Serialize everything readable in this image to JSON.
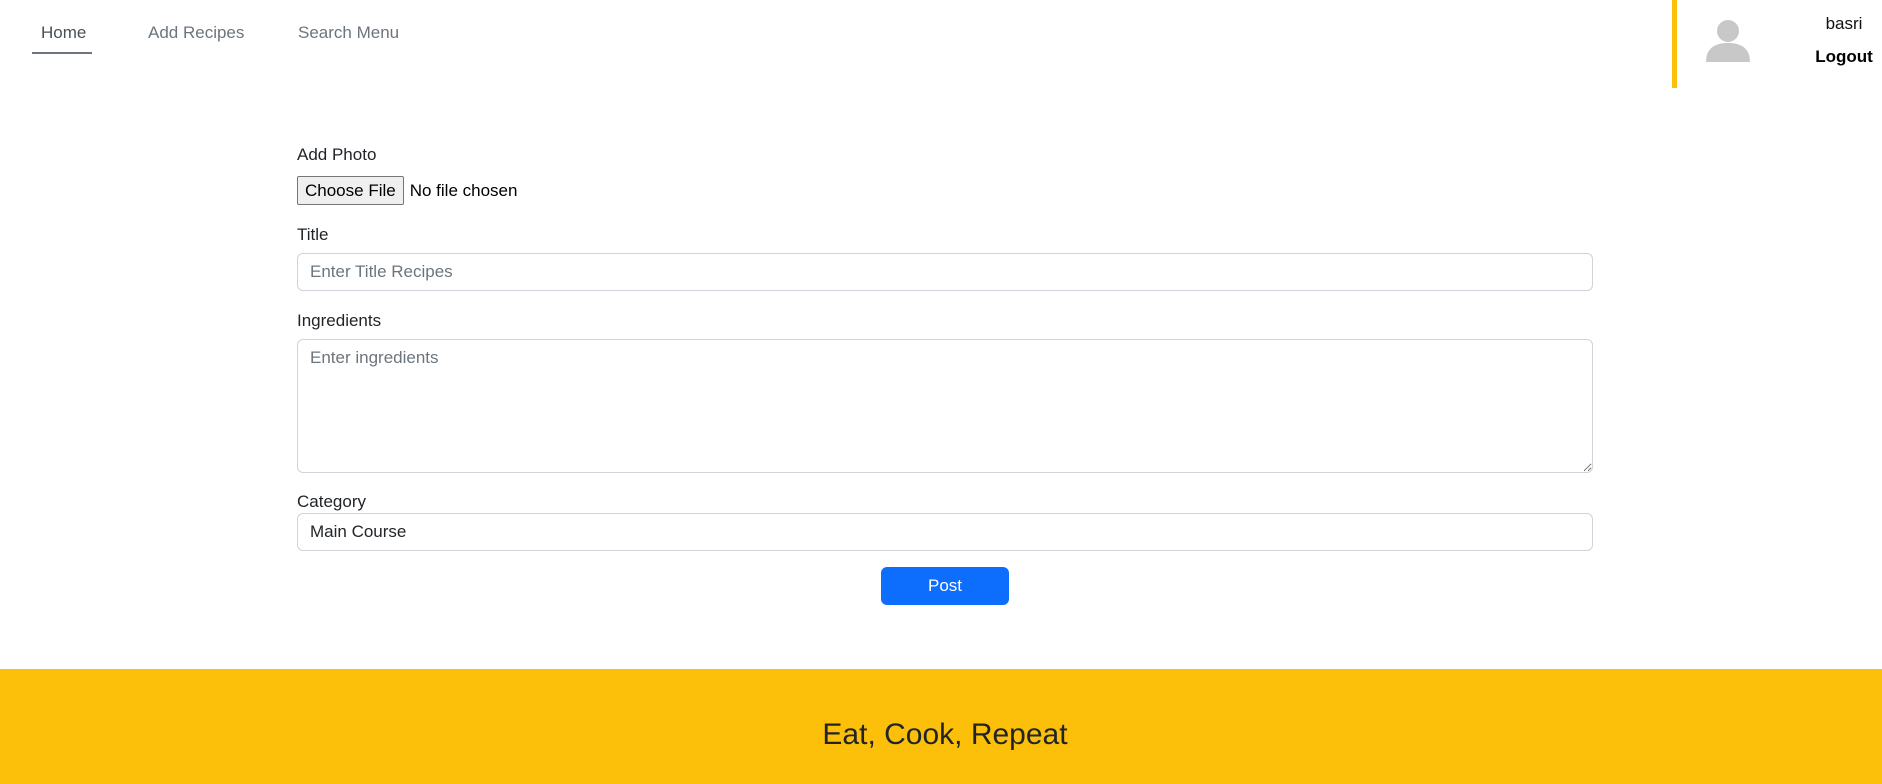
{
  "nav": {
    "home": "Home",
    "add_recipes": "Add Recipes",
    "search_menu": "Search Menu"
  },
  "profile": {
    "username": "basri",
    "logout": "Logout",
    "avatar_icon": "user-silhouette-icon"
  },
  "form": {
    "photo_label": "Add Photo",
    "file_button": "Choose File",
    "file_status": "No file chosen",
    "title_label": "Title",
    "title_placeholder": "Enter Title Recipes",
    "ingredients_label": "Ingredients",
    "ingredients_placeholder": "Enter ingredients",
    "category_label": "Category",
    "category_value": "Main Course",
    "post_button": "Post"
  },
  "footer": {
    "tagline": "Eat, Cook, Repeat"
  },
  "colors": {
    "accent": "#fcbf0a",
    "primary_button": "#0d6efd"
  }
}
